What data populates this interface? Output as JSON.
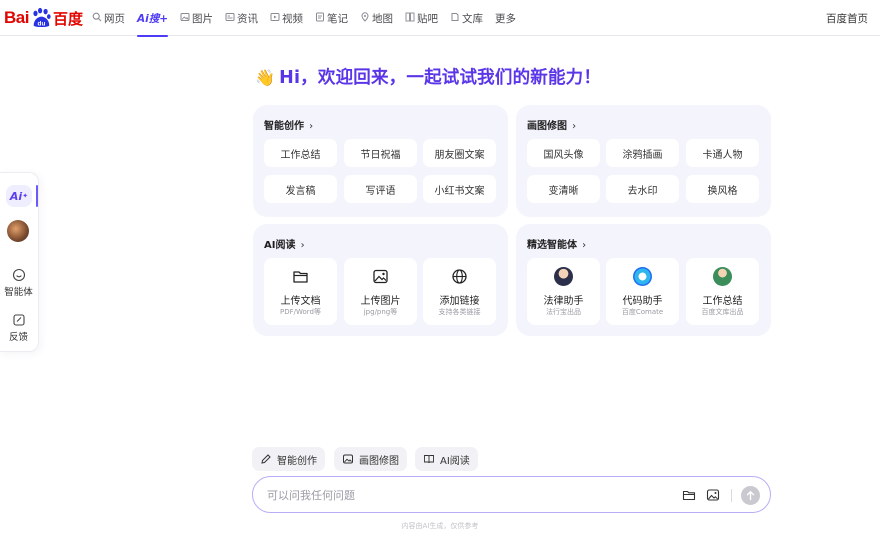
{
  "logo": {
    "bai": "Bai",
    "du": "du",
    "cn": "百度"
  },
  "nav": {
    "items": [
      {
        "label": "网页",
        "icon": "search-icon"
      },
      {
        "label": "Ai搜+",
        "icon": "ai-search-icon",
        "active": true
      },
      {
        "label": "图片",
        "icon": "image-icon"
      },
      {
        "label": "资讯",
        "icon": "news-icon"
      },
      {
        "label": "视频",
        "icon": "video-icon"
      },
      {
        "label": "笔记",
        "icon": "note-icon"
      },
      {
        "label": "地图",
        "icon": "map-icon"
      },
      {
        "label": "贴吧",
        "icon": "tieba-icon"
      },
      {
        "label": "文库",
        "icon": "library-icon"
      },
      {
        "label": "更多",
        "icon": ""
      }
    ],
    "home": "百度首页"
  },
  "rail": {
    "ai_label": "Ai",
    "agent_label": "智能体",
    "feedback_label": "反馈"
  },
  "headline": {
    "wave": "👋",
    "text": "Hi，欢迎回来，一起试试我们的新能力！"
  },
  "cards": {
    "create": {
      "title": "智能创作",
      "chips": [
        "工作总结",
        "节日祝福",
        "朋友圈文案",
        "发言稿",
        "写评语",
        "小红书文案"
      ]
    },
    "image": {
      "title": "画图修图",
      "chips": [
        "国风头像",
        "涂鸦插画",
        "卡通人物",
        "变清晰",
        "去水印",
        "换风格"
      ]
    },
    "read": {
      "title": "AI阅读",
      "tiles": [
        {
          "title": "上传文档",
          "sub": "PDF/Word等",
          "icon": "folder-icon"
        },
        {
          "title": "上传图片",
          "sub": "jpg/png等",
          "icon": "picture-icon"
        },
        {
          "title": "添加链接",
          "sub": "支持各类链接",
          "icon": "globe-icon"
        }
      ]
    },
    "agents": {
      "title": "精选智能体",
      "tiles": [
        {
          "title": "法律助手",
          "sub": "法行宝出品"
        },
        {
          "title": "代码助手",
          "sub": "百度Comate"
        },
        {
          "title": "工作总结",
          "sub": "百度文库出品"
        }
      ]
    }
  },
  "quick": [
    "智能创作",
    "画图修图",
    "AI阅读"
  ],
  "input": {
    "placeholder": "可以问我任何问题"
  },
  "disclaimer": "内容由AI生成，仅供参考",
  "colors": {
    "accent": "#5b36e8",
    "brand_red": "#e10601",
    "card_bg": "#f4f4fd"
  }
}
